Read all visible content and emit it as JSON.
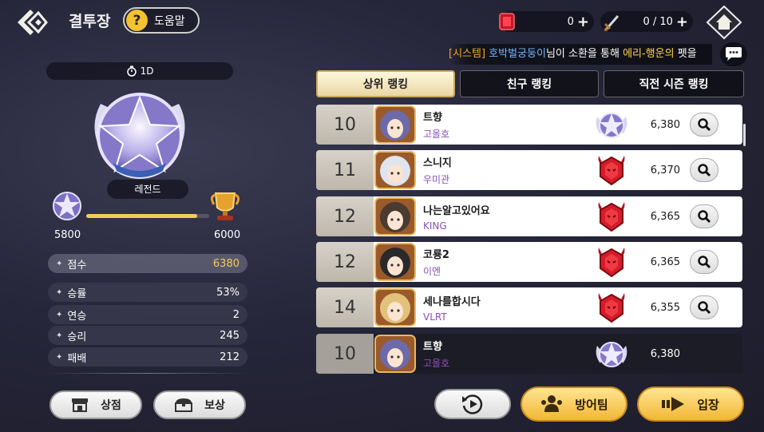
{
  "header": {
    "title": "결투장",
    "help_label": "도움말",
    "help_icon_text": "?",
    "gem_count": "0",
    "ticket_count": "0 / 10"
  },
  "notice": {
    "system_tag": "[시스템]",
    "player_name": "호박벌궁둥이",
    "text": "님이 소환을 통해 ",
    "item_name": "에리-행운의",
    "tail": " 펫을"
  },
  "profile": {
    "season_timer": "1D",
    "tier_name": "레전드",
    "progress_min": "5800",
    "progress_max": "6000",
    "progress_fraction": 0.9,
    "score_label": "점수",
    "score_value": "6380",
    "stats": [
      {
        "label": "승률",
        "value": "53%"
      },
      {
        "label": "연승",
        "value": "2"
      },
      {
        "label": "승리",
        "value": "245"
      },
      {
        "label": "패배",
        "value": "212"
      }
    ],
    "shop_label": "상점",
    "reward_label": "보상"
  },
  "tabs": [
    {
      "label": "상위 랭킹",
      "active": true
    },
    {
      "label": "친구 랭킹",
      "active": false
    },
    {
      "label": "직전 시즌 랭킹",
      "active": false
    }
  ],
  "rankings": [
    {
      "rank": "10",
      "name": "트향",
      "guild": "고올호",
      "tier": "legend",
      "score": "6,380"
    },
    {
      "rank": "11",
      "name": "스니지",
      "guild": "우미관",
      "tier": "demon",
      "score": "6,370"
    },
    {
      "rank": "12",
      "name": "나는알고있어요",
      "guild": "KING",
      "tier": "demon",
      "score": "6,365"
    },
    {
      "rank": "12",
      "name": "코룡2",
      "guild": "이엔",
      "tier": "demon",
      "score": "6,365"
    },
    {
      "rank": "14",
      "name": "세나를합시다",
      "guild": "VLRT",
      "tier": "demon",
      "score": "6,355"
    }
  ],
  "my_rank": {
    "rank": "10",
    "name": "트향",
    "guild": "고올호",
    "tier": "legend",
    "score": "6,380"
  },
  "actions": {
    "defense_label": "방어팀",
    "enter_label": "입장"
  },
  "colors": {
    "gold_accent": "#f2cc59",
    "guild_purple": "#8a4fb8",
    "system_orange": "#f0a62c",
    "name_blue": "#6fb7ff"
  }
}
